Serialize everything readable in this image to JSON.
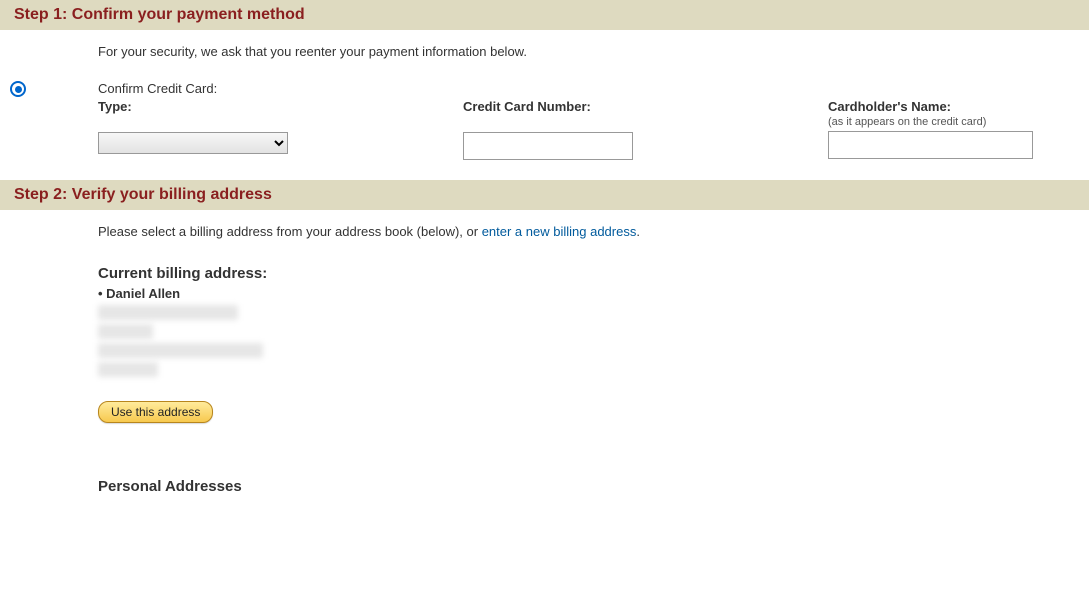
{
  "step1": {
    "title": "Step 1: Confirm your payment method",
    "intro": "For your security, we ask that you reenter your payment information below.",
    "confirm_label": "Confirm Credit Card:",
    "type_label": "Type:",
    "ccnum_label": "Credit Card Number:",
    "name_label": "Cardholder's Name:",
    "name_hint": "(as it appears on the credit card)",
    "type_value": "",
    "ccnum_value": "",
    "name_value": ""
  },
  "step2": {
    "title": "Step 2: Verify your billing address",
    "intro_prefix": "Please select a billing address from your address book (below), or ",
    "intro_link": "enter a new billing address",
    "intro_suffix": ".",
    "current_heading": "Current billing address:",
    "current_name": "Daniel Allen",
    "use_button": "Use this address",
    "personal_heading": "Personal Addresses"
  }
}
